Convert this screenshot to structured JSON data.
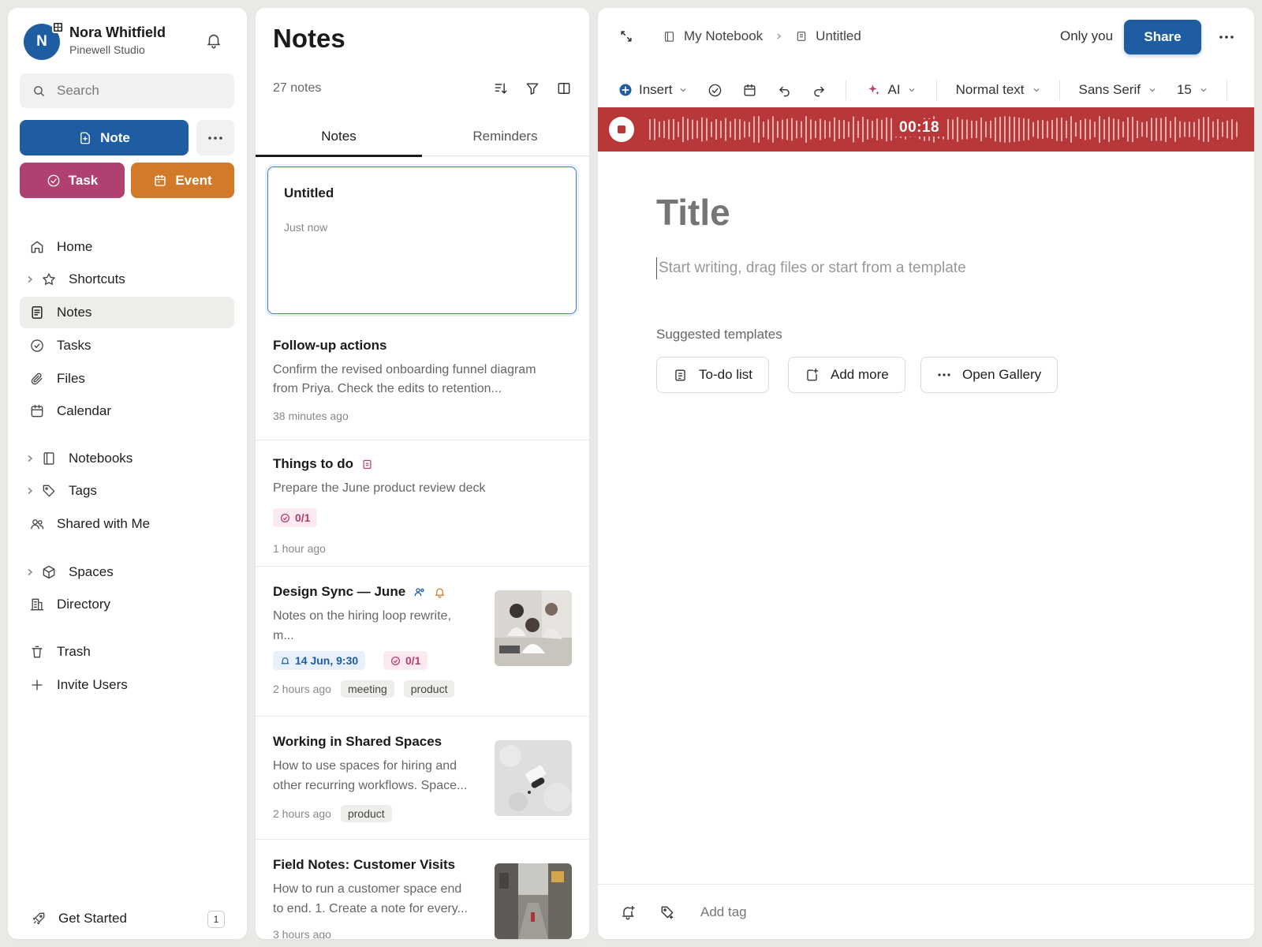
{
  "user": {
    "initial": "N",
    "name": "Nora Whitfield",
    "org": "Pinewell Studio"
  },
  "search": {
    "placeholder": "Search"
  },
  "create": {
    "note_label": "Note",
    "task_label": "Task",
    "event_label": "Event"
  },
  "nav": {
    "home": "Home",
    "shortcuts": "Shortcuts",
    "notes": "Notes",
    "tasks": "Tasks",
    "files": "Files",
    "calendar": "Calendar",
    "notebooks": "Notebooks",
    "tags": "Tags",
    "shared": "Shared with Me",
    "spaces": "Spaces",
    "directory": "Directory",
    "trash": "Trash",
    "invite": "Invite Users"
  },
  "get_started": {
    "label": "Get Started",
    "count": "1"
  },
  "notes_list": {
    "title": "Notes",
    "count": "27 notes",
    "tabs": [
      "Notes",
      "Reminders"
    ],
    "items": [
      {
        "title": "Untitled",
        "time": "Just now"
      },
      {
        "title": "Follow-up actions",
        "snippet1": "Confirm the revised onboarding funnel diagram",
        "snippet2": "from Priya. Check the edits to retention...",
        "time": "38 minutes ago"
      },
      {
        "title": "Things to do",
        "snippet1": "Prepare the June product review deck",
        "task_chip": "0/1",
        "time": "1 hour ago"
      },
      {
        "title": "Design Sync — June",
        "snippet1": "Notes on the hiring loop rewrite,",
        "snippet2": "m...",
        "reminder_chip": "14 Jun, 9:30",
        "task_chip": "0/1",
        "time": "2 hours ago",
        "tags": [
          "meeting",
          "product"
        ]
      },
      {
        "title": "Working in Shared Spaces",
        "snippet1": "How to use spaces for hiring and",
        "snippet2": "other recurring workflows. Space...",
        "time": "2 hours ago",
        "tags": [
          "product"
        ]
      },
      {
        "title": "Field Notes: Customer Visits",
        "snippet1": "How to run a customer space end",
        "snippet2": "to end. 1. Create a note for every...",
        "time": "3 hours ago"
      }
    ]
  },
  "editor": {
    "breadcrumb": [
      "My Notebook",
      "Untitled"
    ],
    "visibility": "Only you",
    "share_label": "Share",
    "toolbar": {
      "insert": "Insert",
      "ai": "AI",
      "text_style": "Normal text",
      "font": "Sans Serif",
      "size": "15"
    },
    "recording_time": "00:18",
    "title_placeholder": "Title",
    "body_placeholder": "Start writing, drag files or start from a template",
    "suggested_label": "Suggested templates",
    "templates": [
      "To-do list",
      "Add more",
      "Open Gallery"
    ],
    "add_tag_placeholder": "Add tag"
  },
  "colors": {
    "primary": "#1f5da3",
    "task": "#b03f72",
    "event": "#d07a2a",
    "recording": "#b8383a"
  }
}
